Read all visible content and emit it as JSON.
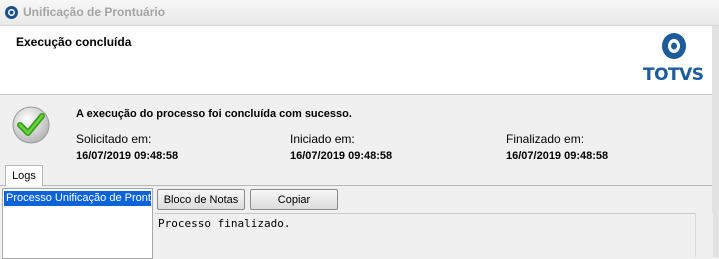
{
  "window": {
    "title": "Unificação de Prontuário"
  },
  "header": {
    "title": "Execução concluída",
    "logo_text": "TOTVS"
  },
  "status": {
    "message": "A execução do processo foi concluída com sucesso.",
    "requested_label": "Solicitado em:",
    "requested_value": "16/07/2019 09:48:58",
    "started_label": "Iniciado em:",
    "started_value": "16/07/2019 09:48:58",
    "finished_label": "Finalizado em:",
    "finished_value": "16/07/2019 09:48:58"
  },
  "tabs": [
    {
      "label": "Logs",
      "active": true
    }
  ],
  "logs": {
    "items": [
      "Processo Unificação de Prontuário"
    ],
    "notepad_button": "Bloco de Notas",
    "copy_button": "Copiar",
    "output": "Processo finalizado."
  },
  "colors": {
    "brand": "#1d5b99",
    "selection": "#0a64d8",
    "success": "#3a9f1e"
  }
}
